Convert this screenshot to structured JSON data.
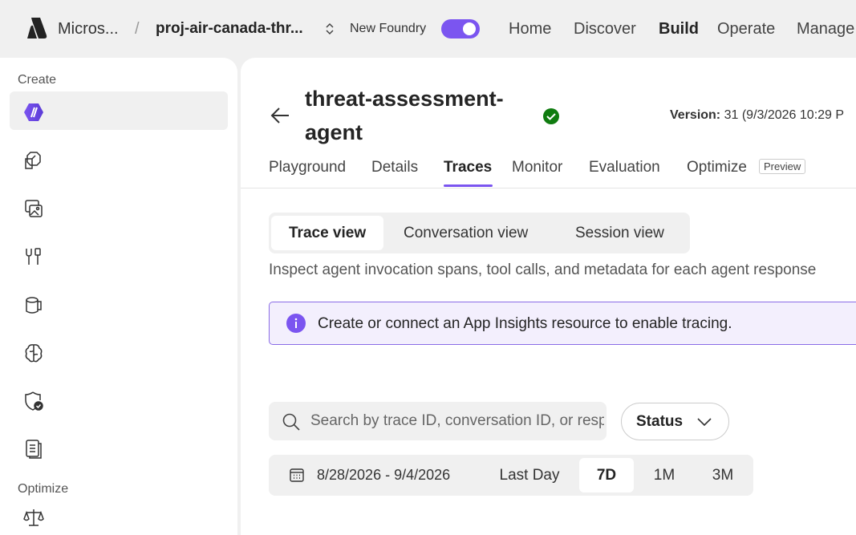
{
  "header": {
    "org": "Micros...",
    "separator": "/",
    "project": "proj-air-canada-thr...",
    "new_foundry_label": "New Foundry",
    "new_foundry_enabled": true,
    "nav": [
      {
        "label": "Home",
        "active": false
      },
      {
        "label": "Discover",
        "active": false
      },
      {
        "label": "Build",
        "active": true
      },
      {
        "label": "Operate",
        "active": false
      },
      {
        "label": "Manage",
        "active": false
      }
    ]
  },
  "sidebar": {
    "create_heading": "Create",
    "optimize_heading": "Optimize",
    "items": [
      {
        "icon": "agents-icon",
        "active": true
      },
      {
        "icon": "models-icon"
      },
      {
        "icon": "images-icon"
      },
      {
        "icon": "tools-icon"
      },
      {
        "icon": "data-icon"
      },
      {
        "icon": "brain-icon"
      },
      {
        "icon": "shield-check-icon"
      },
      {
        "icon": "document-icon"
      },
      {
        "icon": "scale-icon"
      }
    ]
  },
  "agent": {
    "name": "threat-assessment-agent",
    "status": "success",
    "version_label": "Version:",
    "version_value": "31 (9/3/2026 10:29 P"
  },
  "tabs": [
    {
      "label": "Playground"
    },
    {
      "label": "Details"
    },
    {
      "label": "Traces",
      "active": true
    },
    {
      "label": "Monitor"
    },
    {
      "label": "Evaluation"
    },
    {
      "label": "Optimize",
      "badge": "Preview"
    }
  ],
  "views": [
    {
      "label": "Trace view",
      "active": true
    },
    {
      "label": "Conversation view"
    },
    {
      "label": "Session view"
    }
  ],
  "description": "Inspect agent invocation spans, tool calls, and metadata for each agent response",
  "banner": {
    "message": "Create or connect an App Insights resource to enable tracing.",
    "color": "#7b55f0"
  },
  "search": {
    "placeholder": "Search by trace ID, conversation ID, or response ID"
  },
  "status_filter": {
    "label": "Status"
  },
  "date_filter": {
    "range": "8/28/2026 - 9/4/2026",
    "options": [
      {
        "label": "Last Day"
      },
      {
        "label": "7D",
        "active": true
      },
      {
        "label": "1M"
      },
      {
        "label": "3M"
      }
    ]
  },
  "colors": {
    "accent": "#7b55f0",
    "success": "#107c10"
  }
}
